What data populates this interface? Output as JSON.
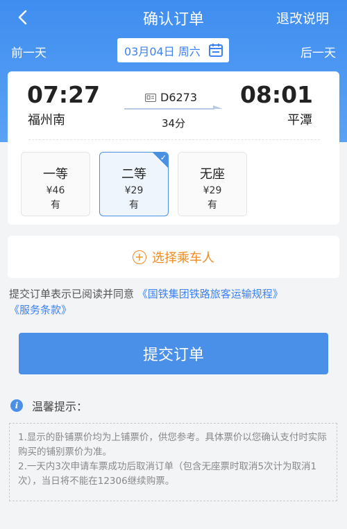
{
  "header": {
    "title": "确认订单",
    "refund_link": "退改说明",
    "prev_day": "前一天",
    "next_day": "后一天",
    "date": "03月04日 周六",
    "accent_color": "#3f8df0"
  },
  "train": {
    "dep_time": "07:27",
    "dep_station": "福州南",
    "arr_time": "08:01",
    "arr_station": "平潭",
    "train_no": "D6273",
    "duration": "34分"
  },
  "seats": [
    {
      "name": "一等",
      "price": "¥46",
      "availability": "有",
      "selected": false
    },
    {
      "name": "二等",
      "price": "¥29",
      "availability": "有",
      "selected": true
    },
    {
      "name": "无座",
      "price": "¥29",
      "availability": "有",
      "selected": false
    }
  ],
  "passenger": {
    "label": "选择乘车人"
  },
  "agreement": {
    "prefix": "提交订单表示已阅读并同意",
    "link1": "《国铁集团铁路旅客运输规程》",
    "link2": "《服务条款》"
  },
  "submit_label": "提交订单",
  "tips": {
    "title": "温馨提示：",
    "line1": "1.显示的卧铺票价均为上铺票价，供您参考。具体票价以您确认支付时实际购买的铺别票价为准。",
    "line2": "2.一天内3次申请车票成功后取消订单（包含无座票时取消5次计为取消1次），当日将不能在12306继续购票。"
  }
}
